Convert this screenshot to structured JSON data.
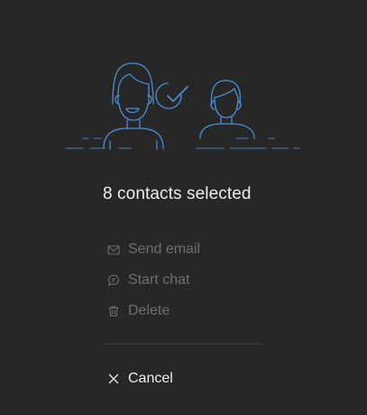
{
  "panel": {
    "title": "8 contacts selected",
    "illustration_icon": "contacts-selected-illustration",
    "accent_color": "#4a8fd6",
    "actions": [
      {
        "label": "Send email",
        "icon": "envelope-icon",
        "enabled": false
      },
      {
        "label": "Start chat",
        "icon": "chat-bubble-icon",
        "enabled": false
      },
      {
        "label": "Delete",
        "icon": "trash-icon",
        "enabled": false
      }
    ],
    "cancel": {
      "label": "Cancel",
      "icon": "close-icon"
    }
  }
}
